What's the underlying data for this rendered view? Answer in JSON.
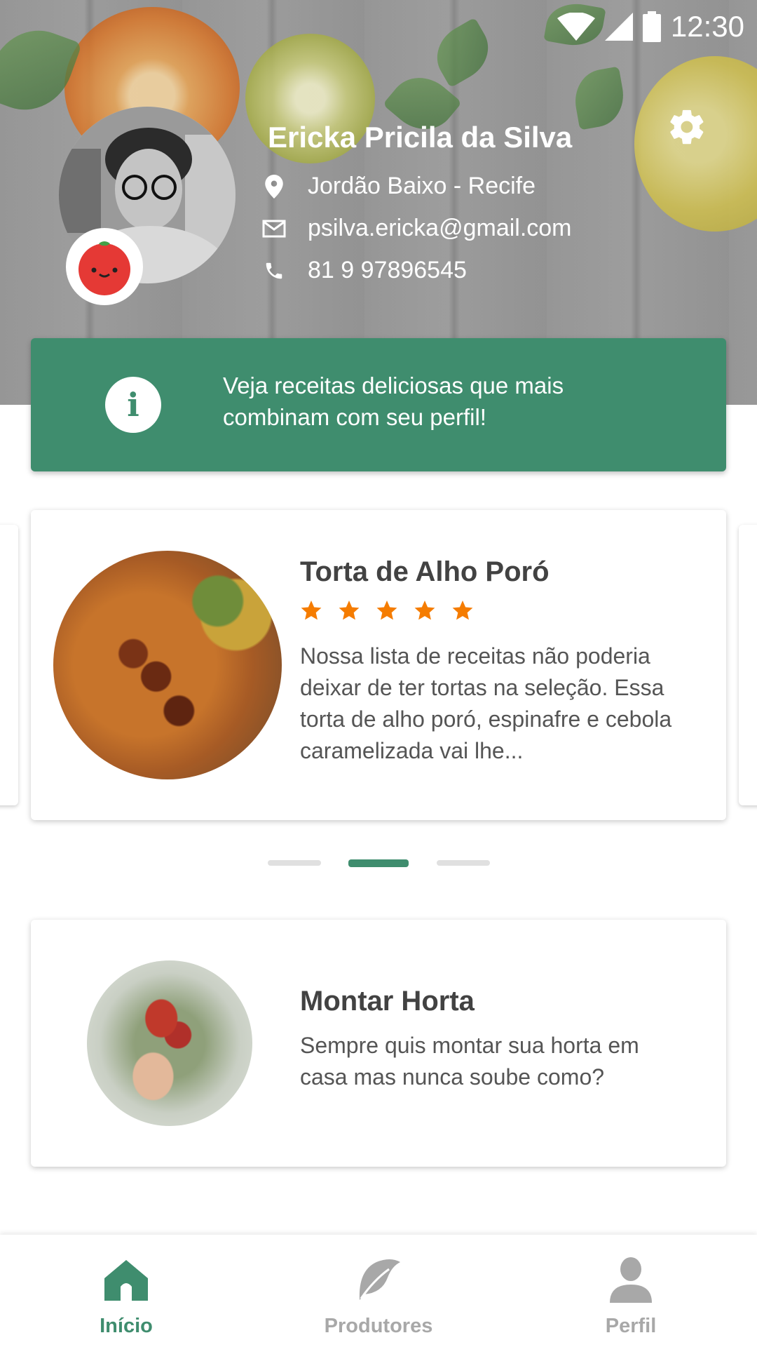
{
  "status_bar": {
    "time": "12:30"
  },
  "profile": {
    "name": "Ericka Pricila da Silva",
    "location": "Jordão Baixo - Recife",
    "email": "psilva.ericka@gmail.com",
    "phone": "81 9 97896545"
  },
  "banner": {
    "message": "Veja receitas deliciosas que mais combinam com seu perfil!"
  },
  "recipe_card": {
    "title": "Torta de Alho Poró",
    "rating": 5,
    "description": "Nossa lista de receitas não poderia deixar de ter tortas na seleção. Essa torta de alho poró, espinafre e cebola caramelizada vai lhe..."
  },
  "carousel": {
    "pages": 3,
    "active_page": 2
  },
  "horta_card": {
    "title": "Montar Horta",
    "description": "Sempre quis montar sua horta em casa mas nunca soube como?"
  },
  "bottom_nav": {
    "items": [
      {
        "label": "Início",
        "icon": "home-icon",
        "active": true
      },
      {
        "label": "Produtores",
        "icon": "leaf-icon",
        "active": false
      },
      {
        "label": "Perfil",
        "icon": "person-icon",
        "active": false
      }
    ]
  },
  "colors": {
    "accent": "#3f8d6e",
    "star": "#f57c00"
  }
}
